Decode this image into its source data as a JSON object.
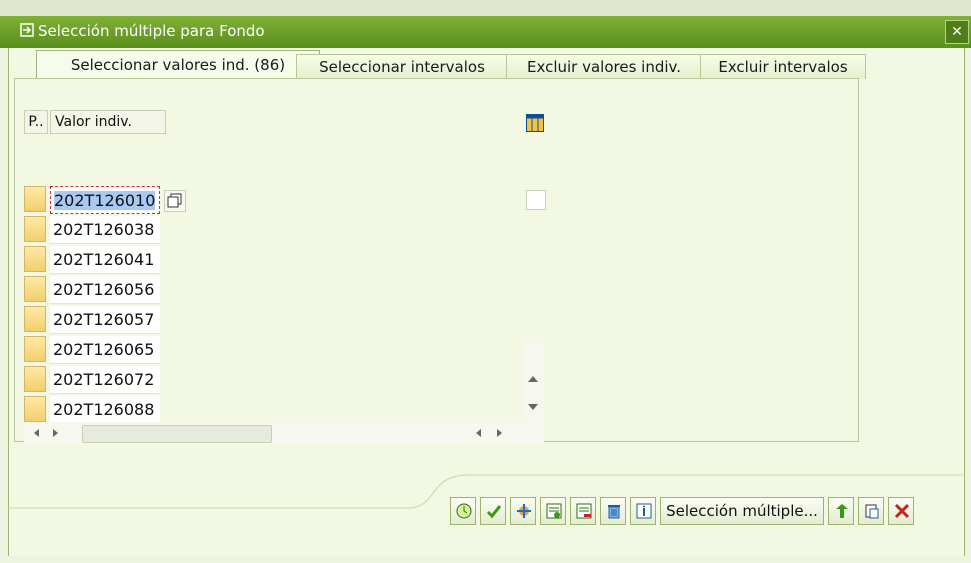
{
  "window": {
    "title": "Selección múltiple para Fondo",
    "close_label": "✕"
  },
  "tabs": [
    {
      "label": "Seleccionar valores ind. (86)",
      "active": true
    },
    {
      "label": "Seleccionar intervalos",
      "active": false
    },
    {
      "label": "Excluir valores indiv.",
      "active": false
    },
    {
      "label": "Excluir intervalos",
      "active": false
    }
  ],
  "grid": {
    "header_p": "P..",
    "header_valor": "Valor indiv.",
    "rows": [
      "202T126010",
      "202T126038",
      "202T126041",
      "202T126056",
      "202T126057",
      "202T126065",
      "202T126072",
      "202T126088"
    ]
  },
  "footer": {
    "multi_select_label": "Selección múltiple..."
  },
  "colors": {
    "title_bar": "#5a8f1d",
    "tab_bg": "#f7fbe9",
    "row_selector": "#f2cf6c",
    "selected_cell": "#a9c9f2"
  }
}
